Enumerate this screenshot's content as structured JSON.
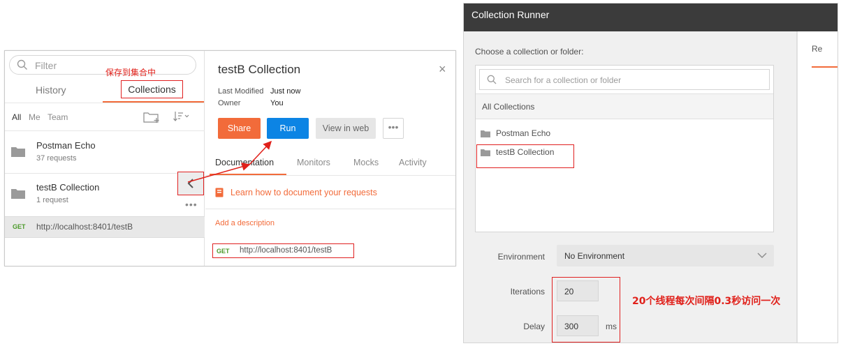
{
  "left": {
    "sidebar": {
      "filter_placeholder": "Filter",
      "annotation_save": "保存到集合中",
      "tabs": {
        "history": "History",
        "collections": "Collections"
      },
      "scope": {
        "all": "All",
        "me": "Me",
        "team": "Team"
      },
      "collections": [
        {
          "name": "Postman Echo",
          "count": "37 requests"
        },
        {
          "name": "testB Collection",
          "count": "1 request"
        }
      ],
      "request": {
        "method": "GET",
        "url": "http://localhost:8401/testB"
      }
    },
    "detail": {
      "title": "testB Collection",
      "close": "×",
      "meta": {
        "last_modified_label": "Last Modified",
        "last_modified_value": "Just now",
        "owner_label": "Owner",
        "owner_value": "You"
      },
      "buttons": {
        "share": "Share",
        "run": "Run",
        "view_in_web": "View in web",
        "more": "•••"
      },
      "tabs": {
        "documentation": "Documentation",
        "monitors": "Monitors",
        "mocks": "Mocks",
        "activity": "Activity"
      },
      "learn_link": "Learn how to document your requests",
      "add_description": "Add a description",
      "request": {
        "method": "GET",
        "url": "http://localhost:8401/testB"
      }
    }
  },
  "runner": {
    "title": "Collection Runner",
    "right_tab": "Re",
    "choose_label": "Choose a collection or folder:",
    "search_placeholder": "Search for a collection or folder",
    "all_collections": "All Collections",
    "items": [
      "Postman Echo",
      "testB Collection"
    ],
    "environment": {
      "label": "Environment",
      "value": "No Environment"
    },
    "iterations": {
      "label": "Iterations",
      "value": "20"
    },
    "delay": {
      "label": "Delay",
      "value": "300",
      "unit": "ms"
    },
    "annotation_threads": "20个线程每次间隔0.3秒访问一次"
  },
  "colors": {
    "accent_orange": "#f26b3a",
    "run_blue": "#0c84e4",
    "annotation_red": "#e0201a",
    "get_green": "#4c9a2a",
    "runner_header": "#3b3b3b"
  }
}
